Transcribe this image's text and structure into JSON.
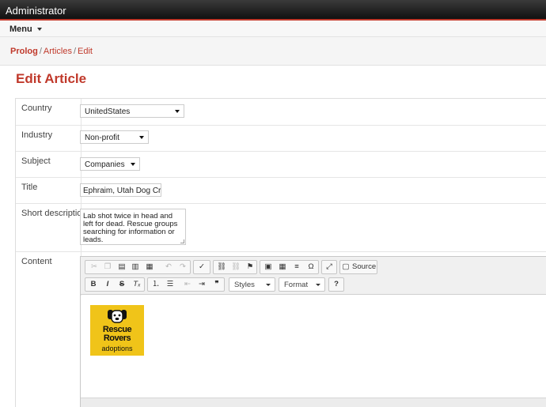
{
  "app": {
    "title": "Administrator"
  },
  "menubar": {
    "menu_label": "Menu"
  },
  "breadcrumb": {
    "items": [
      "Prolog",
      "Articles",
      "Edit"
    ]
  },
  "page": {
    "title": "Edit Article"
  },
  "form": {
    "country": {
      "label": "Country",
      "value": "UnitedStates"
    },
    "industry": {
      "label": "Industry",
      "value": "Non-profit"
    },
    "subject": {
      "label": "Subject",
      "value": "Companies"
    },
    "title": {
      "label": "Title",
      "value": "Ephraim, Utah Dog Cruelt"
    },
    "short_description": {
      "label": "Short description",
      "value": "Lab shot twice in head and left for dead. Rescue groups searching for information or leads."
    },
    "content": {
      "label": "Content"
    }
  },
  "editor": {
    "toolbar": {
      "source_label": "Source",
      "styles_label": "Styles",
      "format_label": "Format",
      "bold_glyph": "B",
      "italic_glyph": "I",
      "strike_glyph": "S",
      "help_glyph": "?",
      "quote_glyph": "❞"
    },
    "logo": {
      "line1": "Rescue",
      "line2": "Rovers",
      "line3": "adoptions"
    }
  },
  "colors": {
    "accent": "#c0392b",
    "logo_bg": "#f0c419"
  }
}
